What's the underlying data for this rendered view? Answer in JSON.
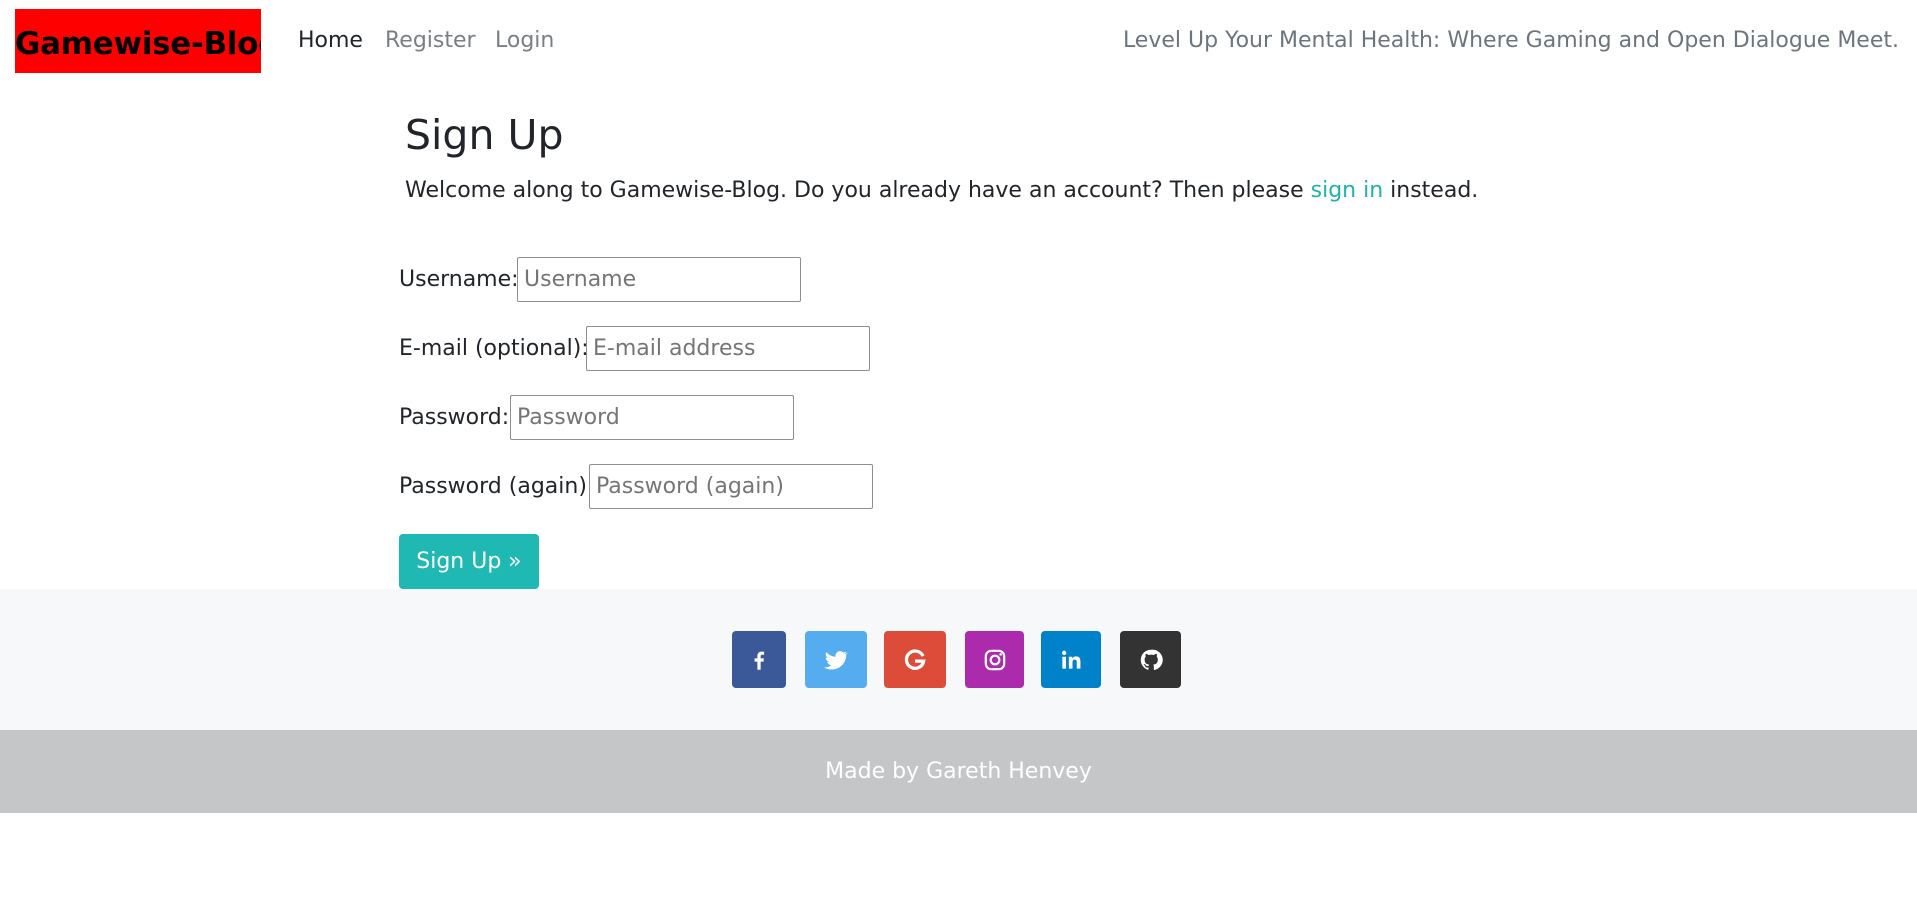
{
  "app": {
    "brand": "Gamewise-Blog",
    "tagline": "Level Up Your Mental Health: Where Gaming and Open Dialogue Meet."
  },
  "nav": {
    "home": "Home",
    "register": "Register",
    "login": "Login"
  },
  "page": {
    "title": "Sign Up",
    "intro_before": "Welcome along to Gamewise-Blog. Do you already have an account? Then please ",
    "intro_link": "sign in",
    "intro_after": " instead."
  },
  "form": {
    "username_label": "Username:",
    "username_placeholder": "Username",
    "username_value": "",
    "email_label": "E-mail (optional):",
    "email_placeholder": "E-mail address",
    "email_value": "",
    "password_label": "Password:",
    "password_placeholder": "Password",
    "password_value": "",
    "password2_label": "Password (again):",
    "password2_placeholder": "Password (again)",
    "password2_value": "",
    "submit_label": "Sign Up »"
  },
  "social": [
    {
      "icon": "facebook-icon",
      "color": "#3b5998"
    },
    {
      "icon": "twitter-icon",
      "color": "#55acee"
    },
    {
      "icon": "google-icon",
      "color": "#dd4b39"
    },
    {
      "icon": "instagram-icon",
      "color": "#ac2bac"
    },
    {
      "icon": "linkedin-icon",
      "color": "#0082ca"
    },
    {
      "icon": "github-icon",
      "color": "#333333"
    }
  ],
  "footer": {
    "credit": "Made by Gareth Henvey"
  },
  "colors": {
    "brand_bg": "#ff0000",
    "accent": "#20b2aa",
    "button": "#20b8b2",
    "footer_bg": "#c5c6c8",
    "social_band_bg": "#f7f8fa"
  }
}
